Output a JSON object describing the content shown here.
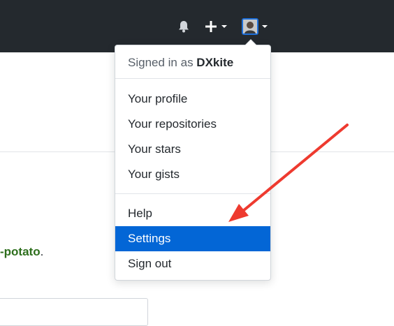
{
  "header": {
    "notifications_icon": "bell-icon",
    "create_icon": "plus-icon",
    "avatar_border_color": "#1e6fd9"
  },
  "user_menu": {
    "signed_in_prefix": "Signed in as ",
    "username": "DXkite",
    "sections": [
      [
        "Your profile",
        "Your repositories",
        "Your stars",
        "Your gists"
      ],
      [
        "Help",
        "Settings",
        "Sign out"
      ]
    ],
    "items": {
      "profile": "Your profile",
      "repositories": "Your repositories",
      "stars": "Your stars",
      "gists": "Your gists",
      "help": "Help",
      "settings": "Settings",
      "signout": "Sign out"
    },
    "active_item": "Settings",
    "active_color": "#0366d6"
  },
  "background": {
    "link_text": "-potato",
    "trailing": "."
  },
  "annotation": {
    "arrow_color": "#ee3a2f"
  }
}
